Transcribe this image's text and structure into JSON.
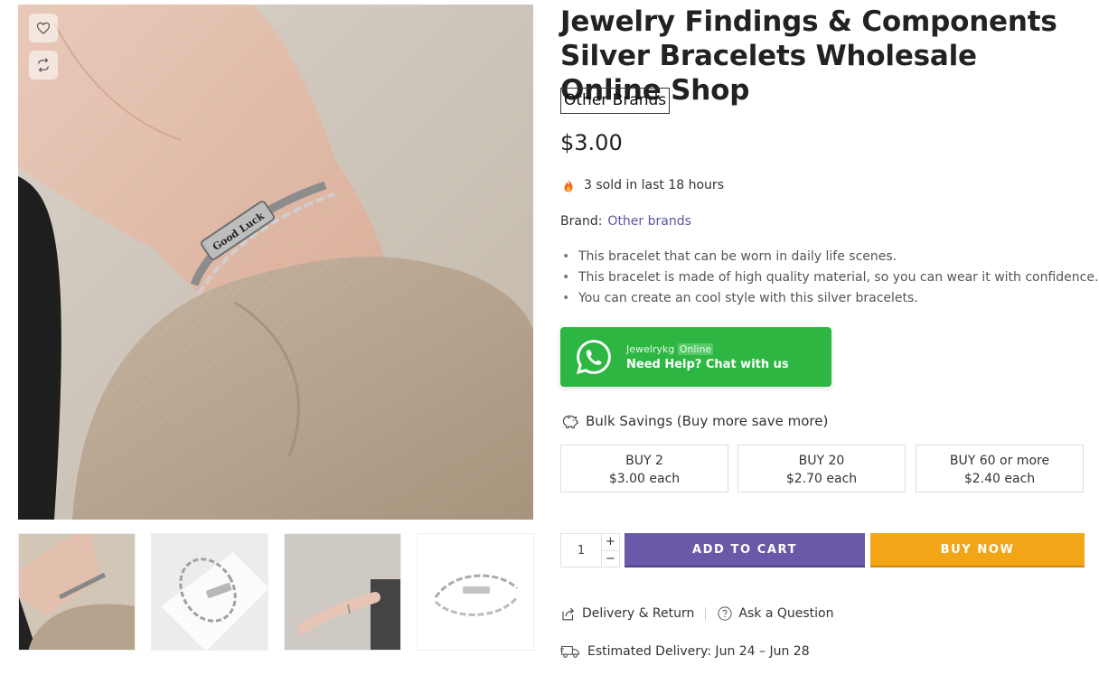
{
  "product": {
    "title": "Jewelry Findings & Components Silver Bracelets Wholesale Online Shop",
    "brand_badge": "Other Brands",
    "price": "$3.00",
    "sold_text": "3 sold in last 18 hours",
    "brand_label": "Brand:",
    "brand_value": "Other brands",
    "bullets": [
      "This bracelet that can be worn in daily life scenes.",
      "This bracelet is made of high quality material, so you can wear it with confidence.",
      "You can create an cool style with this silver bracelets."
    ],
    "engraving_text": "Good Luck"
  },
  "whatsapp": {
    "name": "Jewelrykg",
    "status": "Online",
    "cta": "Need Help? Chat with us",
    "color": "#2db742"
  },
  "bulk": {
    "title": "Bulk Savings (Buy more save more)",
    "tiers": [
      {
        "qty": "BUY 2",
        "price": "$3.00 each"
      },
      {
        "qty": "BUY 20",
        "price": "$2.70 each"
      },
      {
        "qty": "BUY 60 or more",
        "price": "$2.40 each"
      }
    ]
  },
  "purchase": {
    "quantity": "1",
    "plus": "+",
    "minus": "−",
    "add_to_cart": "ADD TO CART",
    "buy_now": "BUY NOW",
    "cart_color": "#6a58a8",
    "buy_color": "#f2a517"
  },
  "links": {
    "delivery_return": "Delivery & Return",
    "ask_question": "Ask a Question",
    "estimated_delivery": "Estimated Delivery: Jun 24 – Jun 28"
  },
  "icons": {
    "wishlist": "heart-icon",
    "compare": "refresh-icon",
    "fire": "fire-icon",
    "piggy": "piggy-bank-icon",
    "share": "share-icon",
    "question": "question-icon",
    "truck": "truck-icon"
  }
}
